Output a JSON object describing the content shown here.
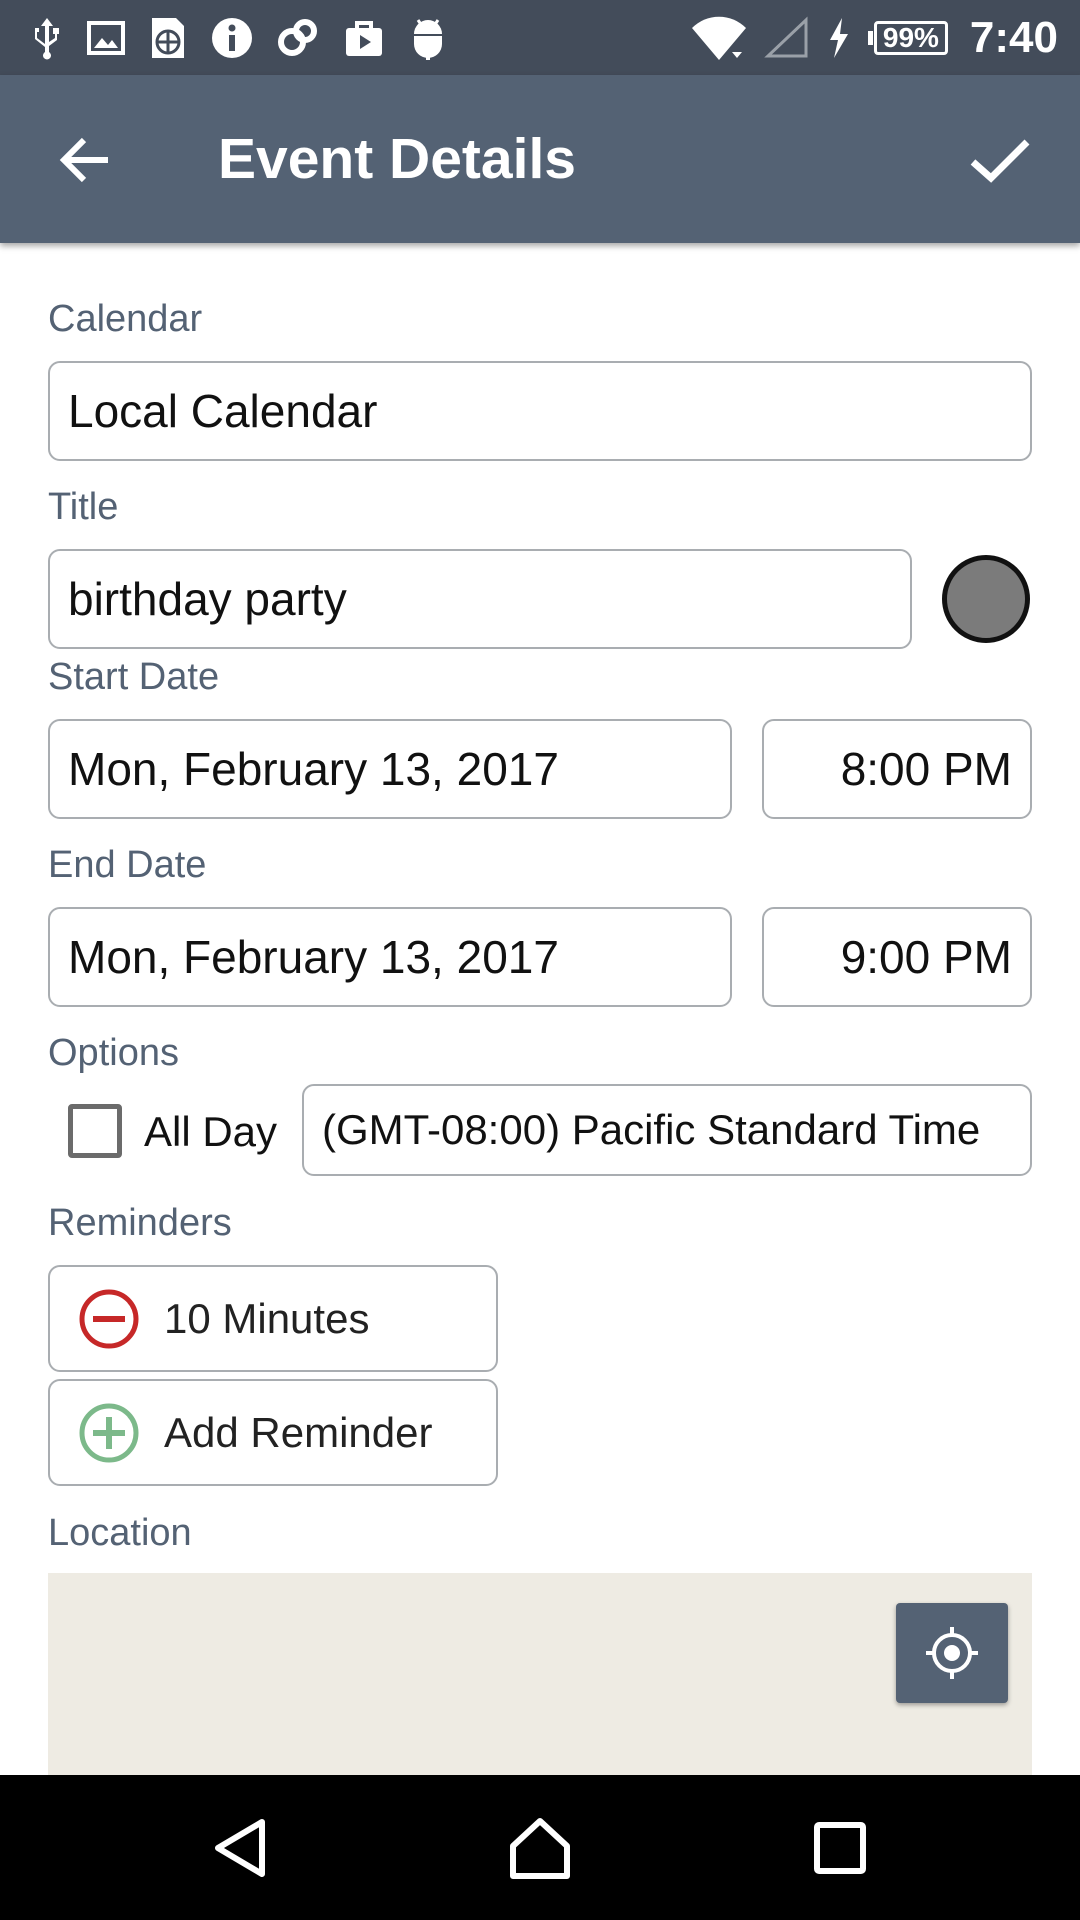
{
  "status_bar": {
    "battery": "99%",
    "time": "7:40"
  },
  "app_bar": {
    "title": "Event Details"
  },
  "form": {
    "calendar_label": "Calendar",
    "calendar_value": "Local Calendar",
    "title_label": "Title",
    "title_value": "birthday party",
    "start_label": "Start Date",
    "start_date": "Mon, February 13, 2017",
    "start_time": "8:00 PM",
    "end_label": "End Date",
    "end_date": "Mon, February 13, 2017",
    "end_time": "9:00 PM",
    "options_label": "Options",
    "all_day_label": "All Day",
    "all_day_checked": false,
    "timezone": "(GMT-08:00) Pacific Standard Time",
    "reminders_label": "Reminders",
    "reminders": [
      {
        "label": "10 Minutes",
        "icon": "remove-circle-icon",
        "color": "#c62828"
      }
    ],
    "add_reminder_label": "Add Reminder",
    "add_reminder_color": "#7cb98a",
    "location_label": "Location",
    "event_color": "#7b7b7b"
  },
  "colors": {
    "primary": "#546274",
    "status_bar": "#434c5a",
    "map_bg": "#eeebe3"
  }
}
